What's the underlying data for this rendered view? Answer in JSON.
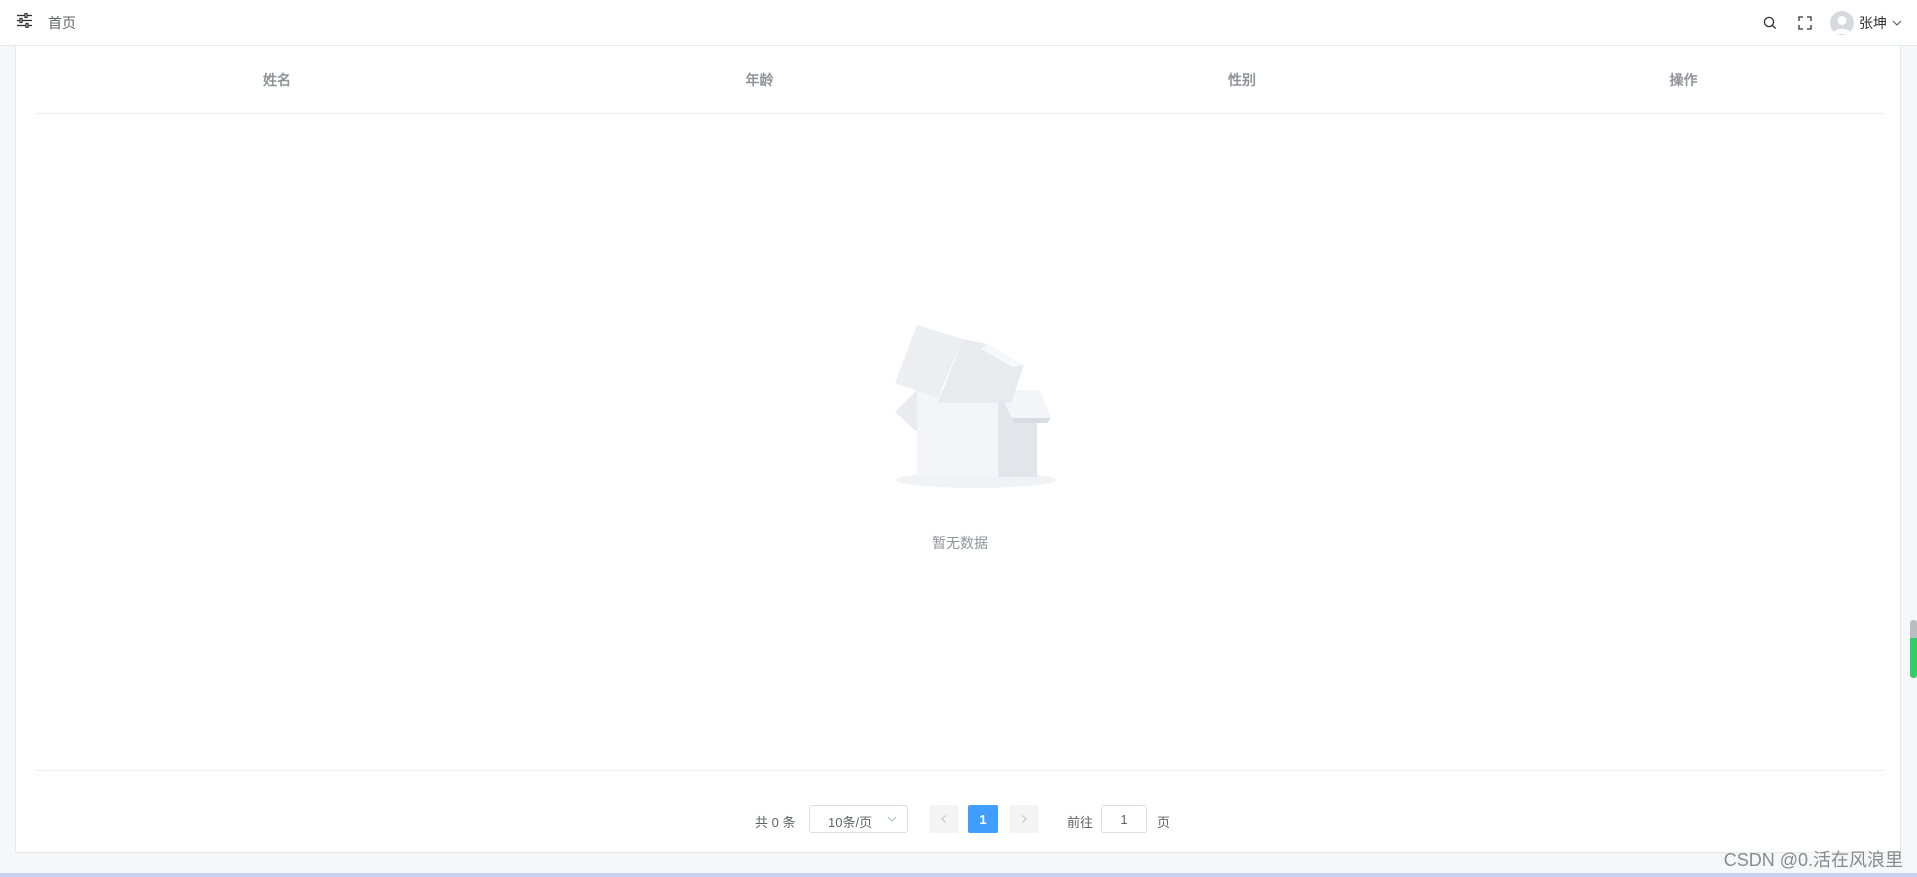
{
  "header": {
    "breadcrumb_home": "首页",
    "user_name": "张坤",
    "icons": [
      "sliders-icon",
      "search-icon",
      "fullscreen-icon",
      "avatar-icon",
      "chevron-down-icon"
    ]
  },
  "table": {
    "columns": [
      "姓名",
      "年龄",
      "性别",
      "操作"
    ],
    "rows": [],
    "empty_text": "暂无数据"
  },
  "pagination": {
    "total_text": "共 0 条",
    "page_size": "10条/页",
    "current_page": "1",
    "goto_label": "前往",
    "goto_value": "1",
    "goto_suffix": "页"
  },
  "watermark": "CSDN @0.活在风浪里",
  "colors": {
    "primary": "#409eff",
    "empty_text": "#909399",
    "scroll_accent": "#2fd06a"
  }
}
